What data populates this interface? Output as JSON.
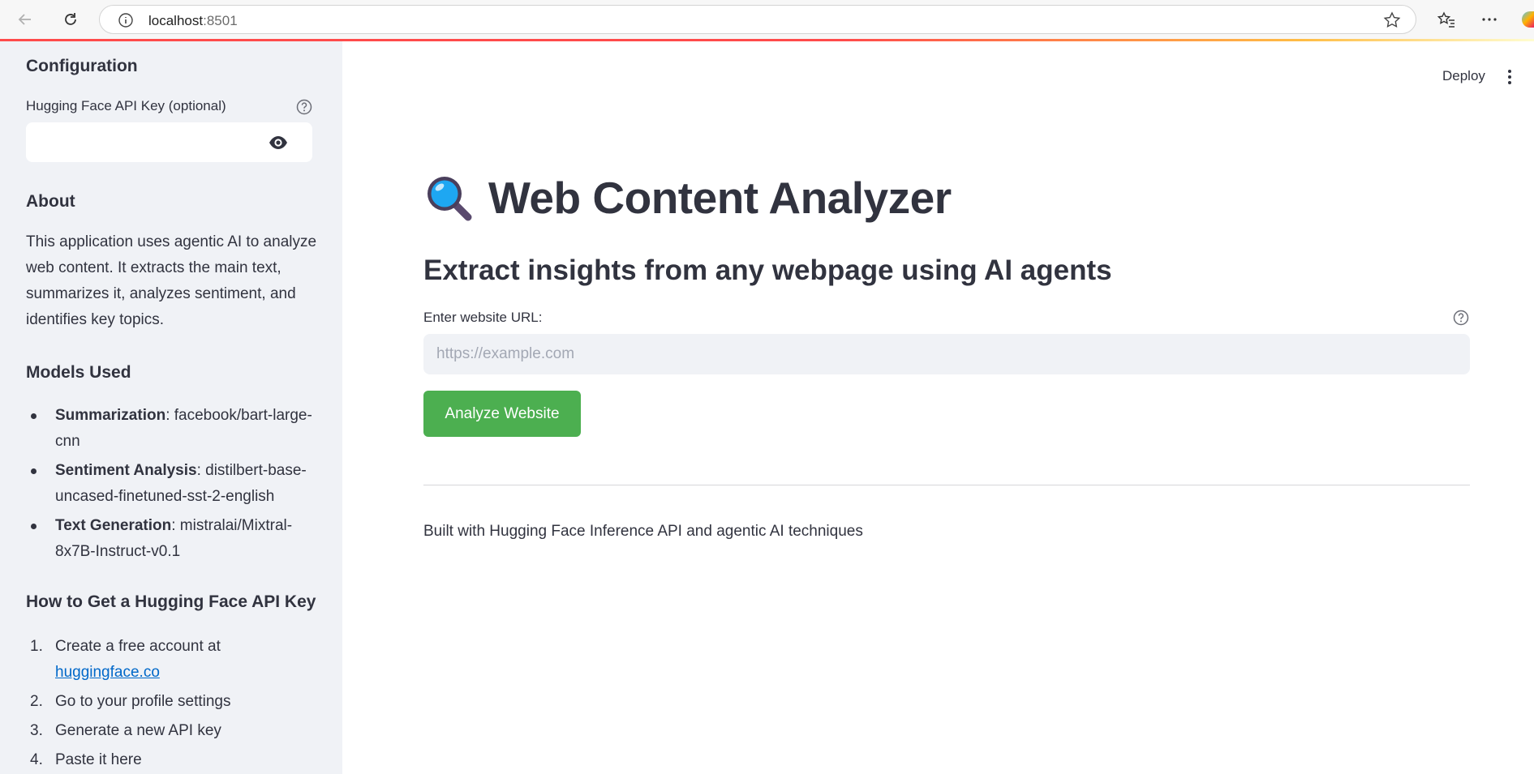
{
  "browser": {
    "url_host": "localhost",
    "url_port": ":8501"
  },
  "sidebar": {
    "config_heading": "Configuration",
    "api_key_label": "Hugging Face API Key (optional)",
    "api_key_value": "",
    "about_heading": "About",
    "about_text": "This application uses agentic AI to analyze web content. It extracts the main text, summarizes it, analyzes sentiment, and identifies key topics.",
    "models_heading": "Models Used",
    "models": [
      {
        "name": "Summarization",
        "value": ": facebook/bart-large-cnn"
      },
      {
        "name": "Sentiment Analysis",
        "value": ": distilbert-base-uncased-finetuned-sst-2-english"
      },
      {
        "name": "Text Generation",
        "value": ": mistralai/Mixtral-8x7B-Instruct-v0.1"
      }
    ],
    "howto_heading": "How to Get a Hugging Face API Key",
    "steps": [
      {
        "num": "1.",
        "text": "Create a free account at ",
        "link": "huggingface.co"
      },
      {
        "num": "2.",
        "text": "Go to your profile settings"
      },
      {
        "num": "3.",
        "text": "Generate a new API key"
      },
      {
        "num": "4.",
        "text": "Paste it here"
      }
    ]
  },
  "header": {
    "deploy_label": "Deploy"
  },
  "main": {
    "title_icon": "magnifying-glass-icon",
    "title": "Web Content Analyzer",
    "subtitle": "Extract insights from any webpage using AI agents",
    "url_label": "Enter website URL:",
    "url_placeholder": "https://example.com",
    "url_value": "",
    "analyze_label": "Analyze Website",
    "footer": "Built with Hugging Face Inference API and agentic AI techniques"
  },
  "colors": {
    "accent": "#ff4b4b",
    "button": "#4caf50",
    "sidebar_bg": "#f0f2f6",
    "link": "#0068c9"
  }
}
